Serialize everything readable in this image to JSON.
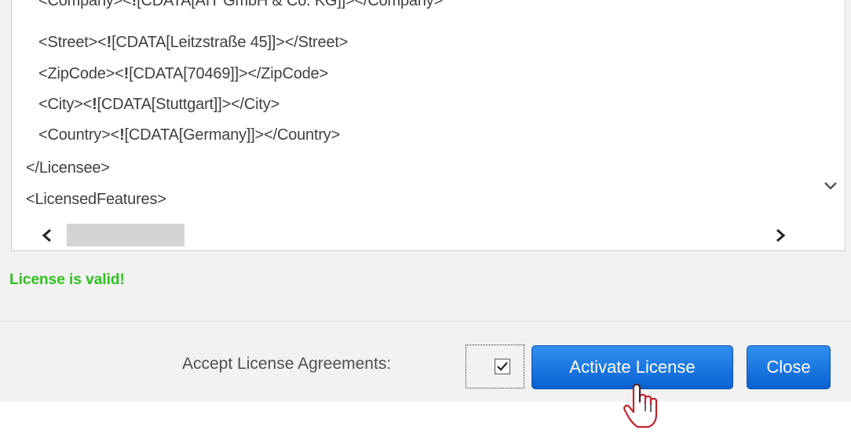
{
  "xml": {
    "lines": [
      {
        "pre": "<Company><",
        "bang": "!",
        "post": "[CDATA[AIT GmbH & Co. KG]]></Company>"
      },
      {
        "pre": "<Street><",
        "bang": "!",
        "post": "[CDATA[Leitzstraße 45]]></Street>"
      },
      {
        "pre": "<ZipCode><",
        "bang": "!",
        "post": "[CDATA[70469]]></ZipCode>"
      },
      {
        "pre": "<City><",
        "bang": "!",
        "post": "[CDATA[Stuttgart]]></City>"
      },
      {
        "pre": "<Country><",
        "bang": "!",
        "post": "[CDATA[Germany]]></Country>"
      },
      {
        "text": "</Licensee>"
      },
      {
        "text": "<LicensedFeatures>"
      }
    ]
  },
  "status": {
    "text": "License is valid!",
    "color": "#2ec11e"
  },
  "footer": {
    "accept_label": "Accept License Agreements:",
    "accept_checked": true,
    "activate_label": "Activate License",
    "close_label": "Close"
  },
  "icons": {
    "scroll_down": "chevron-down-icon",
    "scroll_left": "chevron-left-icon",
    "scroll_right": "chevron-right-icon",
    "cursor": "hand-pointer-icon"
  },
  "colors": {
    "button": "#1a74e0",
    "panel": "#f2f2f2"
  }
}
